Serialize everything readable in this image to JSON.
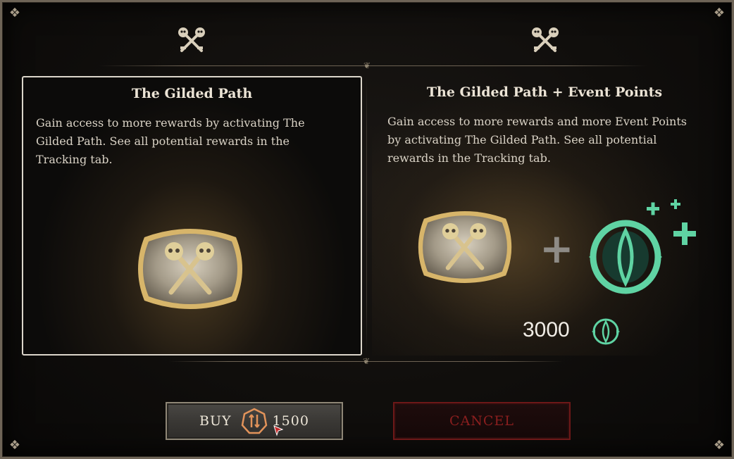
{
  "dialog": {
    "left_option": {
      "title": "The Gilded Path",
      "description": "Gain access to more rewards by activating The Gilded Path. See all potential rewards in the Tracking tab.",
      "icon": "crossed-skull-keys-icon",
      "emblem": "gilded-path-emblem-icon"
    },
    "right_option": {
      "title": "The Gilded Path + Event Points",
      "description": "Gain access to more rewards and more Event Points by activating The Gilded Path. See all potential rewards in the Tracking tab.",
      "icon": "crossed-skull-keys-icon",
      "emblem": "gilded-path-emblem-icon",
      "bonus_icon": "event-points-icon",
      "event_points_amount": "3000"
    },
    "buttons": {
      "buy_label": "BUY",
      "buy_price": "1500",
      "currency_icon": "platinum-currency-icon",
      "cancel_label": "CANCEL"
    }
  },
  "colors": {
    "accent_teal": "#5fd3a3",
    "gold": "#c9a862",
    "cancel_red": "#8a1e1e",
    "frame": "#6e6457"
  }
}
